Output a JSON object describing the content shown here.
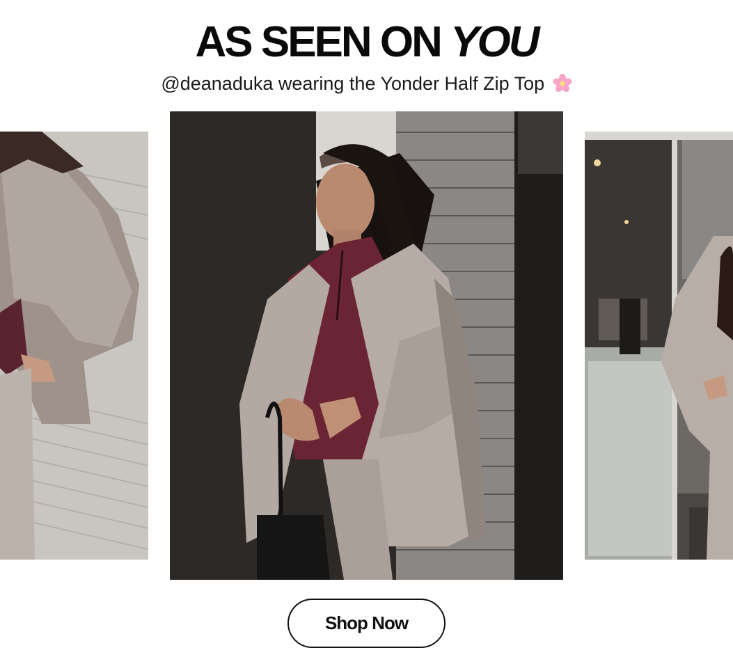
{
  "header": {
    "title_main": "AS SEEN ON ",
    "title_emphasis": "YOU",
    "subtitle": "@deanaduka wearing the Yonder Half Zip Top",
    "subtitle_icon": "cherry-blossom-icon"
  },
  "gallery": {
    "photos": [
      {
        "name": "photo-left",
        "subject": "woman in taupe jacket against white siding"
      },
      {
        "name": "photo-center",
        "subject": "woman in burgundy half zip top and taupe jacket against brick wall"
      },
      {
        "name": "photo-right",
        "subject": "woman in taupe jacket by glass storefront"
      }
    ]
  },
  "cta": {
    "label": "Shop Now"
  },
  "colors": {
    "text": "#0a0a0a",
    "jacket": "#b5aba4",
    "top": "#6b2433",
    "wall_dark": "#2e2a27",
    "brick": "#8f8c89"
  }
}
